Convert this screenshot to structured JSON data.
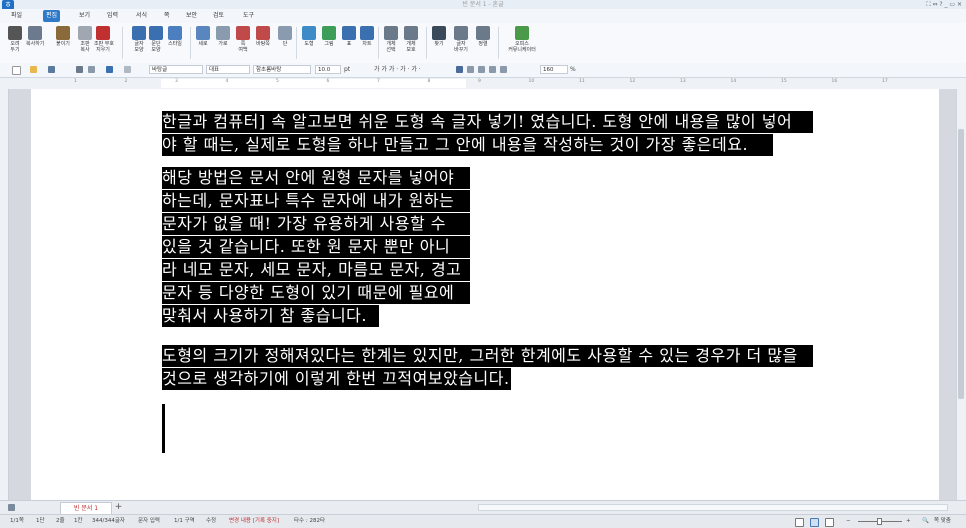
{
  "window": {
    "title": "빈 문서 1 - 혼글",
    "controls": "⛶ ⇔ ?  _ ▭ ✕"
  },
  "menu": {
    "items": [
      "파일",
      "편집",
      "보기",
      "입력",
      "서식",
      "쪽",
      "보안",
      "검토",
      "도구"
    ],
    "active": "편집"
  },
  "ribbon": {
    "buttons": [
      {
        "label": "오려\n두기",
        "icon": "scissors-icon",
        "color": "#555555"
      },
      {
        "label": "복사하기",
        "icon": "copy-icon",
        "color": "#6b7a8c"
      },
      {
        "label": "붙이기",
        "icon": "paste-icon",
        "color": "#8a6a3a"
      },
      {
        "label": "조판\n복사",
        "icon": "format-copy-icon",
        "color": "#a0a7b0"
      },
      {
        "label": "조판 부호\n지우기",
        "icon": "erase-format-icon",
        "color": "#c03030"
      },
      {
        "label": "글자\n모양",
        "icon": "char-shape-icon",
        "color": "#3a6fb0"
      },
      {
        "label": "문단\n모양",
        "icon": "para-shape-icon",
        "color": "#3a6fb0"
      },
      {
        "label": "스타일",
        "icon": "style-icon",
        "color": "#4b7fbf"
      },
      {
        "label": "세로",
        "icon": "portrait-icon",
        "color": "#5a86c0"
      },
      {
        "label": "가로",
        "icon": "landscape-icon",
        "color": "#8a9bb0"
      },
      {
        "label": "쪽\n여백",
        "icon": "margin-icon",
        "color": "#c04a4a"
      },
      {
        "label": "바탕쪽",
        "icon": "master-page-icon",
        "color": "#c04a4a"
      },
      {
        "label": "단",
        "icon": "columns-icon",
        "color": "#8a9bb0"
      },
      {
        "label": "도형",
        "icon": "shape-icon",
        "color": "#3f8bc8"
      },
      {
        "label": "그림",
        "icon": "image-icon",
        "color": "#3f9d5a"
      },
      {
        "label": "표",
        "icon": "table-icon",
        "color": "#3a6fb0"
      },
      {
        "label": "차트",
        "icon": "chart-icon",
        "color": "#3a6fb0"
      },
      {
        "label": "개체\n선택",
        "icon": "select-object-icon",
        "color": "#6a7a8a"
      },
      {
        "label": "개체\n보호",
        "icon": "protect-object-icon",
        "color": "#6a7a8a"
      },
      {
        "label": "찾기",
        "icon": "find-icon",
        "color": "#3a4a5a"
      },
      {
        "label": "글자\n바꾸기",
        "icon": "replace-icon",
        "color": "#6a7a8a"
      },
      {
        "label": "정렬",
        "icon": "sort-icon",
        "color": "#6a7a8a"
      },
      {
        "label": "오피스\n커뮤니케이터",
        "icon": "communicator-icon",
        "color": "#4a9a4a"
      }
    ]
  },
  "toolbar": {
    "style": "바탕글",
    "lang": "대표",
    "font": "함초롬바탕",
    "size": "10.0",
    "size_unit": "pt",
    "char_buttons": "가 가 가 · 가 · 가 ·",
    "zoom": "160",
    "zoom_unit": "%"
  },
  "ruler": {
    "numbers": [
      "1",
      "2",
      "3",
      "4",
      "5",
      "6",
      "7",
      "8",
      "9",
      "10",
      "11",
      "12",
      "13",
      "14",
      "15",
      "16",
      "17"
    ]
  },
  "document": {
    "paragraphs": [
      {
        "lines": [
          "한글과 컴퓨터] 속 알고보면 쉬운 도형 속 글자 넣기! 였습니다. 도형 안에 내용을 많이 넣어",
          "야 할 때는, 실제로 도형을 하나 만들고 그 안에 내용을 작성하는 것이 가장 좋은데요."
        ]
      },
      {
        "lines": [
          "해당 방법은 문서 안에 원형  문자를 넣어야",
          "하는데, 문자표나 특수 문자에 내가 원하는",
          "문자가 없을 때! 가장 유용하게 사용할 수",
          "있을 것 같습니다. 또한 원 문자 뿐만 아니",
          "라 네모 문자, 세모 문자, 마름모 문자, 경고",
          "문자 등 다양한 도형이 있기 때문에 필요에",
          "맞춰서 사용하기 참 좋습니다."
        ]
      },
      {
        "lines": [
          "도형의 크기가 정해져있다는 한계는 있지만, 그러한 한계에도 사용할 수 있는 경우가 더 많을",
          "것으로 생각하기에 이렇게 한번 끄적여보았습니다."
        ]
      }
    ]
  },
  "tabs": {
    "doc_tab": "빈 문서 1",
    "add": "+"
  },
  "status": {
    "page": "1/1쪽",
    "section": "1단",
    "line": "2줄",
    "col": "1칸",
    "chars": "344/344글자",
    "input_mode": "문자 입력",
    "section_count": "1/1 구역",
    "edit_mode": "수정",
    "track_changes": "변경 내용 [기록 중지]",
    "keystrokes": "타수 : 282타",
    "zoom_label": "쪽 맞춤"
  }
}
